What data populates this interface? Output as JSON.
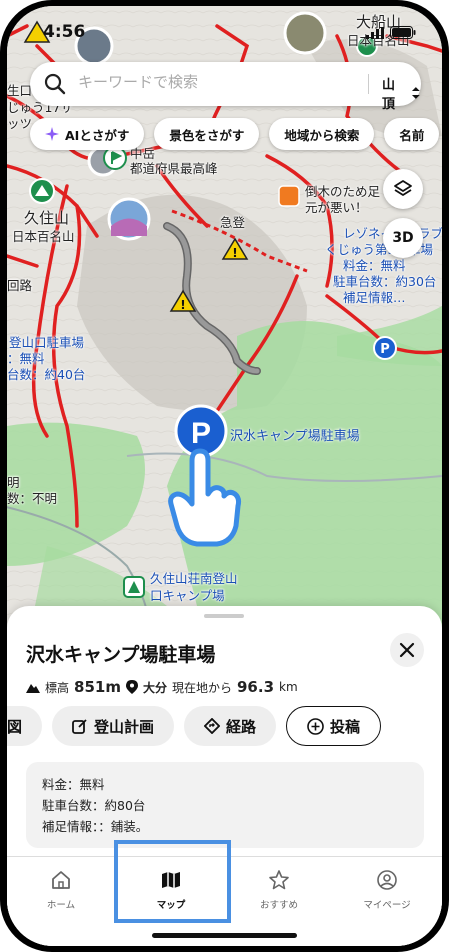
{
  "status": {
    "time": "4:56"
  },
  "search": {
    "placeholder": "キーワードで検索",
    "filter_label": "山頂"
  },
  "chips": [
    {
      "label": "AIとさがす",
      "icon": "sparkle-icon"
    },
    {
      "label": "景色をさがす"
    },
    {
      "label": "地域から検索"
    },
    {
      "label": "名前"
    }
  ],
  "map_buttons": {
    "layers_icon": "layers-icon",
    "3d_label": "3D"
  },
  "map_labels": {
    "kujusan": "久住山",
    "kujusan_sub": "日本百名山",
    "daisenzan": "大船山",
    "daisenzan_sub": "日本百名山",
    "nakadake": "中岳",
    "nakadake_sub": "都道府県最高峰",
    "kyuto": "急登",
    "fallen_tree_1": "倒木のため足",
    "fallen_tree_2": "元が悪い！",
    "rezonate_1": "レゾネイトクラブ",
    "rezonate_2": "くじゅう第3駐車場",
    "rezonate_3": "料金：無料",
    "rezonate_4": "駐車台数：約30台",
    "rezonate_5": "補足情報…",
    "tozan_1": "登山口駐車場",
    "tozan_2": "：無料",
    "tozan_3": "台数：約40台",
    "left_1": "生口",
    "left_2": "じゅう17サ",
    "left_3": "ッツ",
    "left_4": "回路",
    "left_5": "明",
    "left_6": "数：不明",
    "camp_1": "久住山荘南登山",
    "camp_2": "口キャンプ場",
    "pin": "沢水キャンプ場駐車場"
  },
  "sheet": {
    "title": "沢水キャンプ場駐車場",
    "elevation_label": "標高",
    "elevation": "851m",
    "prefecture": "大分",
    "distance_label": "現在地から",
    "distance_value": "96.3",
    "distance_unit": "km",
    "actions": [
      {
        "label": "図"
      },
      {
        "label": "登山計画"
      },
      {
        "label": "経路"
      },
      {
        "label": "投稿"
      }
    ],
    "info": [
      "料金：無料",
      "駐車台数：約80台",
      "補足情報：：鋪装。"
    ]
  },
  "tabs": [
    {
      "label": "ホーム",
      "icon": "home-icon"
    },
    {
      "label": "マップ",
      "icon": "map-icon",
      "active": true
    },
    {
      "label": "おすすめ",
      "icon": "star-icon"
    },
    {
      "label": "マイページ",
      "icon": "user-icon"
    }
  ],
  "colors": {
    "accent": "#1a5fd0",
    "trail": "#e02020",
    "highlight": "#4a90e2"
  }
}
